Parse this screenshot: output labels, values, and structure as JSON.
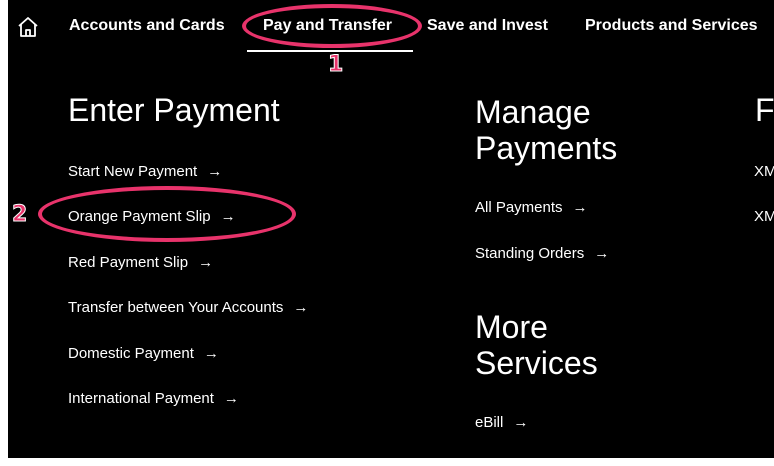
{
  "nav": {
    "items": [
      {
        "label": "Accounts and Cards"
      },
      {
        "label": "Pay and Transfer"
      },
      {
        "label": "Save and Invest"
      },
      {
        "label": "Products and Services"
      }
    ]
  },
  "enter_payment": {
    "title": "Enter Payment",
    "links": [
      {
        "label": "Start New Payment"
      },
      {
        "label": "Orange Payment Slip"
      },
      {
        "label": "Red Payment Slip"
      },
      {
        "label": "Transfer between Your Accounts"
      },
      {
        "label": "Domestic Payment"
      },
      {
        "label": "International Payment"
      }
    ]
  },
  "manage_payments": {
    "title_line1": "Manage",
    "title_line2": "Payments",
    "links": [
      {
        "label": "All Payments"
      },
      {
        "label": "Standing Orders"
      }
    ]
  },
  "more_services": {
    "title_line1": "More",
    "title_line2": "Services",
    "links": [
      {
        "label": "eBill"
      }
    ]
  },
  "third_column": {
    "title_fragment": "F",
    "links": [
      {
        "label": "XM"
      },
      {
        "label": "XM"
      }
    ]
  },
  "annotations": {
    "step1": "1",
    "step2": "2",
    "highlight_color": "#e8336b"
  },
  "icons": {
    "home": "home-icon",
    "arrow": "→"
  }
}
